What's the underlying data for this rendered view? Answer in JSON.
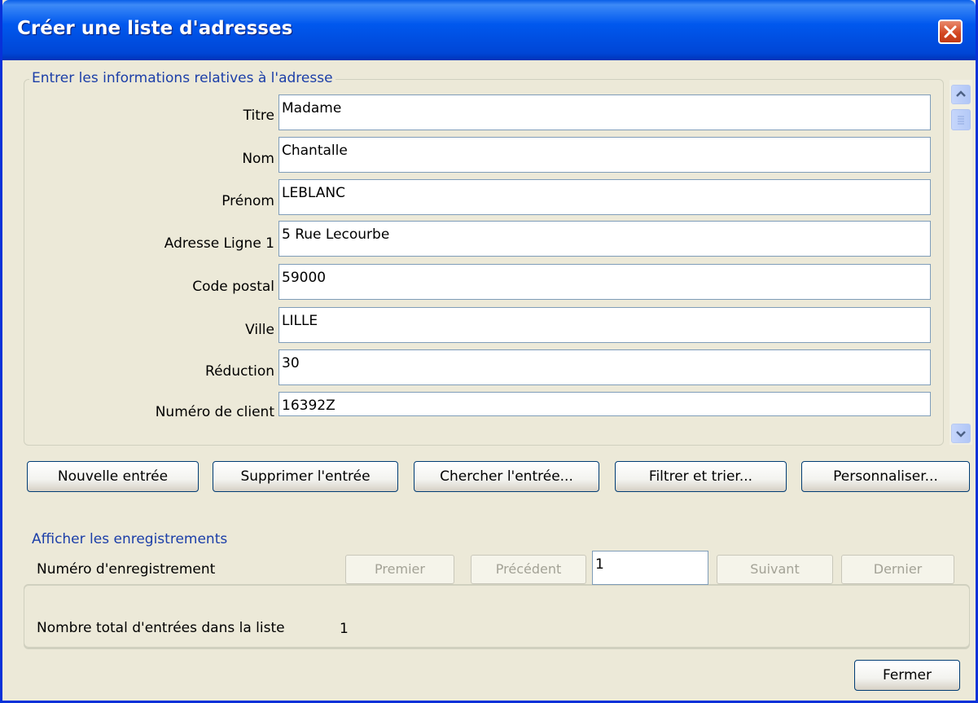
{
  "window": {
    "title": "Créer une liste d'adresses",
    "close_icon": "close-icon"
  },
  "address_group": {
    "legend": "Entrer les informations relatives à l'adresse",
    "fields": [
      {
        "label": "Titre",
        "value": "Madame"
      },
      {
        "label": "Nom",
        "value": "Chantalle"
      },
      {
        "label": "Prénom",
        "value": "LEBLANC"
      },
      {
        "label": "Adresse Ligne 1",
        "value": "5 Rue Lecourbe"
      },
      {
        "label": "Code postal",
        "value": "59000"
      },
      {
        "label": "Ville",
        "value": "LILLE"
      },
      {
        "label": "Réduction",
        "value": "30"
      },
      {
        "label": "Numéro de client",
        "value": "16392Z"
      }
    ]
  },
  "actions": {
    "new_entry": "Nouvelle entrée",
    "delete_entry": "Supprimer l'entrée",
    "find_entry": "Chercher l'entrée...",
    "filter_sort": "Filtrer et trier...",
    "customize": "Personnaliser..."
  },
  "records": {
    "legend": "Afficher les enregistrements",
    "record_number_label": "Numéro d'enregistrement",
    "first": "Premier",
    "previous": "Précédent",
    "current_record": "1",
    "next": "Suivant",
    "last": "Dernier",
    "total_label": "Nombre total d'entrées dans la liste",
    "total_value": "1"
  },
  "footer": {
    "close": "Fermer"
  },
  "colors": {
    "titlebar": "#0058ee",
    "dialog_bg": "#ece9d8",
    "legend_text": "#1b3ea8",
    "close_button": "#d2451f"
  }
}
